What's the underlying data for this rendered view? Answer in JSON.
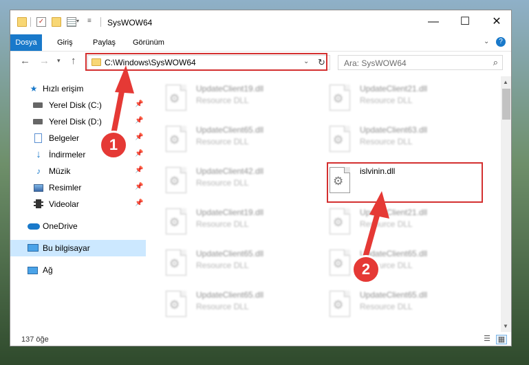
{
  "window": {
    "title": "SysWOW64",
    "controls": {
      "minimize": "—",
      "maximize": "☐",
      "close": "✕"
    }
  },
  "ribbon": {
    "tabs": [
      "Dosya",
      "Giriş",
      "Paylaş",
      "Görünüm"
    ],
    "active_tab": "Dosya",
    "help": "?"
  },
  "nav": {
    "address": "C:\\Windows\\SysWOW64",
    "search_placeholder": "Ara: SysWOW64"
  },
  "sidebar": {
    "items": [
      {
        "label": "Hızlı erişim",
        "icon": "star-icon",
        "pinned": false
      },
      {
        "label": "Yerel Disk (C:)",
        "icon": "drive-icon",
        "pinned": true
      },
      {
        "label": "Yerel Disk (D:)",
        "icon": "drive-icon",
        "pinned": true
      },
      {
        "label": "Belgeler",
        "icon": "documents-icon",
        "pinned": true
      },
      {
        "label": "İndirmeler",
        "icon": "download-icon",
        "pinned": true
      },
      {
        "label": "Müzik",
        "icon": "music-icon",
        "pinned": true
      },
      {
        "label": "Resimler",
        "icon": "pictures-icon",
        "pinned": true
      },
      {
        "label": "Videolar",
        "icon": "videos-icon",
        "pinned": true
      },
      {
        "label": "OneDrive",
        "icon": "cloud-icon",
        "pinned": false
      },
      {
        "label": "Bu bilgisayar",
        "icon": "computer-icon",
        "pinned": false,
        "selected": true
      },
      {
        "label": "Ağ",
        "icon": "network-icon",
        "pinned": false
      }
    ]
  },
  "files": [
    {
      "name": "UpdateClient19.dll",
      "type": "Resource DLL"
    },
    {
      "name": "UpdateClient21.dll",
      "type": "Resource DLL"
    },
    {
      "name": "UpdateClient65.dll",
      "type": "Resource DLL"
    },
    {
      "name": "UpdateClient63.dll",
      "type": "Resource DLL"
    },
    {
      "name": "UpdateClient42.dll",
      "type": "Resource DLL"
    },
    {
      "name": "islvinin.dll",
      "type": ""
    },
    {
      "name": "UpdateClient19.dll",
      "type": "Resource DLL"
    },
    {
      "name": "UpdateClient21.dll",
      "type": "Resource DLL"
    },
    {
      "name": "UpdateClient65.dll",
      "type": "Resource DLL"
    },
    {
      "name": "UpdateClient65.dll",
      "type": "Resource DLL"
    },
    {
      "name": "UpdateClient65.dll",
      "type": "Resource DLL"
    },
    {
      "name": "UpdateClient65.dll",
      "type": "Resource DLL"
    }
  ],
  "status": {
    "count": "137 öğe"
  },
  "callouts": [
    "1",
    "2"
  ],
  "colors": {
    "accent": "#1979ca",
    "highlight": "#d32f2f",
    "selected": "#cce8ff"
  }
}
